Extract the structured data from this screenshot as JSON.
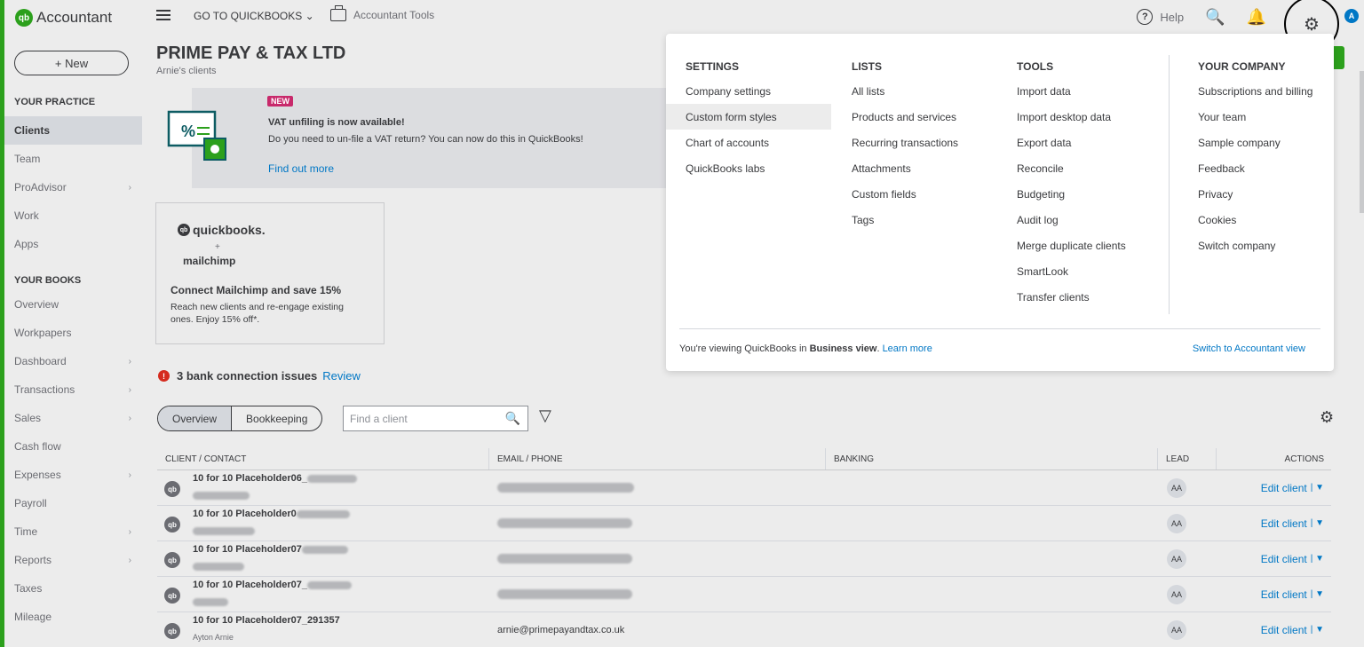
{
  "brand": {
    "logo": "qb",
    "name": "Accountant"
  },
  "sidebar": {
    "new_label": "+ New",
    "section_practice": "YOUR PRACTICE",
    "practice_items": [
      {
        "label": "Clients"
      },
      {
        "label": "Team"
      },
      {
        "label": "ProAdvisor"
      },
      {
        "label": "Work"
      },
      {
        "label": "Apps"
      }
    ],
    "section_books": "YOUR BOOKS",
    "book_items": [
      {
        "label": "Overview"
      },
      {
        "label": "Workpapers"
      },
      {
        "label": "Dashboard"
      },
      {
        "label": "Transactions"
      },
      {
        "label": "Sales"
      },
      {
        "label": "Cash flow"
      },
      {
        "label": "Expenses"
      },
      {
        "label": "Payroll"
      },
      {
        "label": "Time"
      },
      {
        "label": "Reports"
      },
      {
        "label": "Taxes"
      },
      {
        "label": "Mileage"
      }
    ]
  },
  "topbar": {
    "goto": "GO TO QUICKBOOKS ⌄",
    "accountant_tools": "Accountant Tools",
    "help": "Help",
    "help_glyph": "?",
    "avatar": "A",
    "search_glyph": "🔍",
    "bell_glyph": "🔔",
    "gear_glyph": "⚙"
  },
  "main": {
    "company": "PRIME PAY & TAX LTD",
    "company_sub": "Arnie's clients",
    "banner": {
      "badge": "NEW",
      "title": "VAT unfiling is now available!",
      "text": "Do you need to un-file a VAT return? You can now do this in QuickBooks!",
      "link": "Find out more",
      "icon_text": "%"
    },
    "promo": {
      "qb_logo": "quickbooks.",
      "plus": "+",
      "mc_logo": "mailchimp",
      "title": "Connect Mailchimp and save 15%",
      "text": "Reach new clients and re-engage existing ones. Enjoy 15% off*."
    },
    "bank": {
      "icon": "!",
      "text": "3 bank connection issues",
      "review": "Review"
    },
    "tabs": [
      "Overview",
      "Bookkeeping"
    ],
    "search_placeholder": "Find a client",
    "search_glyph": "🔍",
    "filter_glyph": "▽",
    "settings_glyph": "⚙",
    "table": {
      "headers": [
        "CLIENT / CONTACT",
        "EMAIL / PHONE",
        "BANKING",
        "LEAD",
        "ACTIONS"
      ],
      "rows": [
        {
          "name": "10 for 10 Placeholder06_",
          "contact": "",
          "email": "",
          "lead": "AA",
          "action": "Edit client"
        },
        {
          "name": "10 for 10 Placeholder0",
          "contact": "",
          "email": "",
          "lead": "AA",
          "action": "Edit client"
        },
        {
          "name": "10 for 10 Placeholder07",
          "contact": "",
          "email": "",
          "lead": "AA",
          "action": "Edit client"
        },
        {
          "name": "10 for 10 Placeholder07_",
          "contact": "",
          "email": "",
          "lead": "AA",
          "action": "Edit client"
        },
        {
          "name": "10 for 10 Placeholder07_291357",
          "contact": "Ayton Arnie",
          "email": "arnie@primepayandtax.co.uk",
          "lead": "AA",
          "action": "Edit client"
        }
      ]
    }
  },
  "dropdown": {
    "settings": {
      "title": "SETTINGS",
      "items": [
        "Company settings",
        "Custom form styles",
        "Chart of accounts",
        "QuickBooks labs"
      ]
    },
    "lists": {
      "title": "LISTS",
      "items": [
        "All lists",
        "Products and services",
        "Recurring transactions",
        "Attachments",
        "Custom fields",
        "Tags"
      ]
    },
    "tools": {
      "title": "TOOLS",
      "items": [
        "Import data",
        "Import desktop data",
        "Export data",
        "Reconcile",
        "Budgeting",
        "Audit log",
        "Merge duplicate clients",
        "SmartLook",
        "Transfer clients"
      ]
    },
    "company": {
      "title": "YOUR COMPANY",
      "items": [
        "Subscriptions and billing",
        "Your team",
        "Sample company",
        "Feedback",
        "Privacy",
        "Cookies",
        "Switch company"
      ]
    },
    "footer_pre": "You're viewing QuickBooks in ",
    "footer_bold": "Business view",
    "footer_post": ". ",
    "footer_link": "Learn more",
    "switch": "Switch to Accountant view"
  }
}
